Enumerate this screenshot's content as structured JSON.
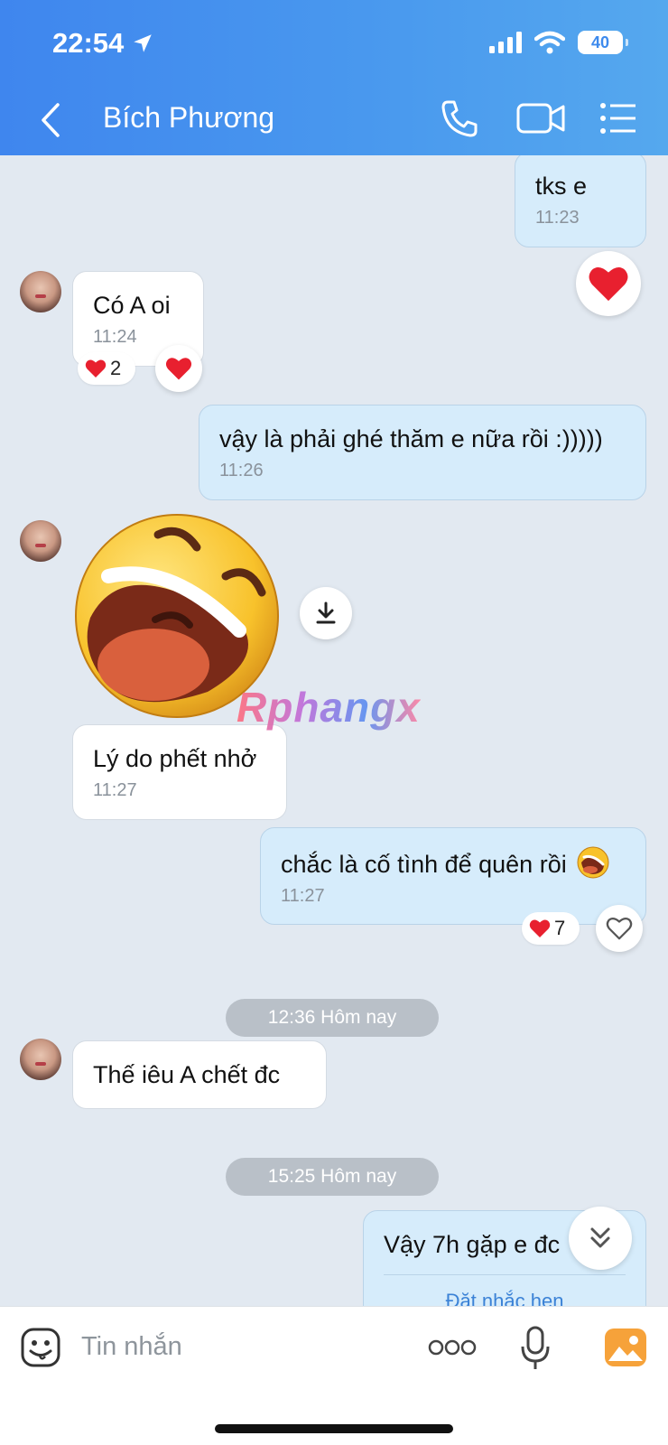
{
  "status_bar": {
    "time": "22:54",
    "battery": "40"
  },
  "header": {
    "title": "Bích Phương"
  },
  "messages": [
    {
      "text": "tks e",
      "time": "11:23"
    },
    {
      "text": "Có A oi",
      "time": "11:24",
      "reaction_count": "2"
    },
    {
      "text": "vậy là phải ghé thăm e nữa rồi :)))))",
      "time": "11:26"
    },
    {
      "text": "Lý do phết nhở",
      "time": "11:27"
    },
    {
      "text": "chắc là cố tình để quên rồi",
      "time": "11:27",
      "reaction_count": "7"
    },
    {
      "text": "Thế iêu A chết đc"
    },
    {
      "text": "Vậy 7h gặp e đc",
      "partial": "Đặt nhắc hẹn"
    }
  ],
  "dividers": [
    "12:36 Hôm nay",
    "15:25 Hôm nay"
  ],
  "watermark": "Rphangx",
  "composer": {
    "placeholder": "Tin nhắn"
  },
  "colors": {
    "header_start": "#3f86ee",
    "header_end": "#55a8ee",
    "outgoing_bubble": "#d6ecfb",
    "incoming_bubble": "#ffffff",
    "chat_bg": "#e2e9f1",
    "heart": "#e8202f"
  },
  "icons": [
    "location-arrow-icon",
    "signal-icon",
    "wifi-icon",
    "back-icon",
    "phone-icon",
    "video-icon",
    "menu-icon",
    "heart-icon",
    "download-icon",
    "chevron-double-down-icon",
    "sticker-icon",
    "more-icon",
    "mic-icon",
    "image-icon"
  ]
}
